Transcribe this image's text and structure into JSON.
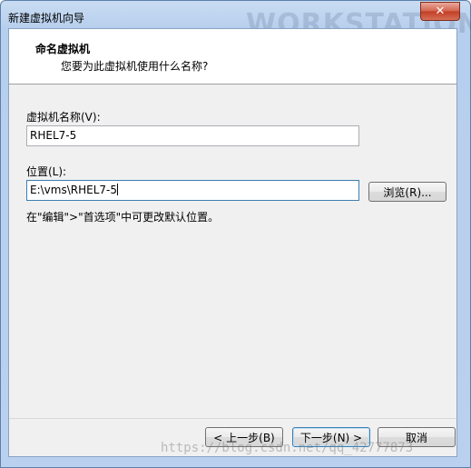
{
  "window": {
    "title": "新建虚拟机向导",
    "watermark_text": "WORKSTATION",
    "close_glyph": "✕"
  },
  "header": {
    "title": "命名虚拟机",
    "subtitle": "您要为此虚拟机使用什么名称?"
  },
  "form": {
    "vm_name_label": "虚拟机名称(V):",
    "vm_name_value": "RHEL7-5",
    "location_label": "位置(L):",
    "location_value": "E:\\vms\\RHEL7-5",
    "browse_label": "浏览(R)...",
    "hint": "在\"编辑\">\"首选项\"中可更改默认位置。"
  },
  "footer": {
    "back_label": "< 上一步(B)",
    "next_label": "下一步(N) >",
    "cancel_label": "取消"
  },
  "overlay": {
    "url_watermark": "https://blog.csdn.net/qq_42777873"
  }
}
